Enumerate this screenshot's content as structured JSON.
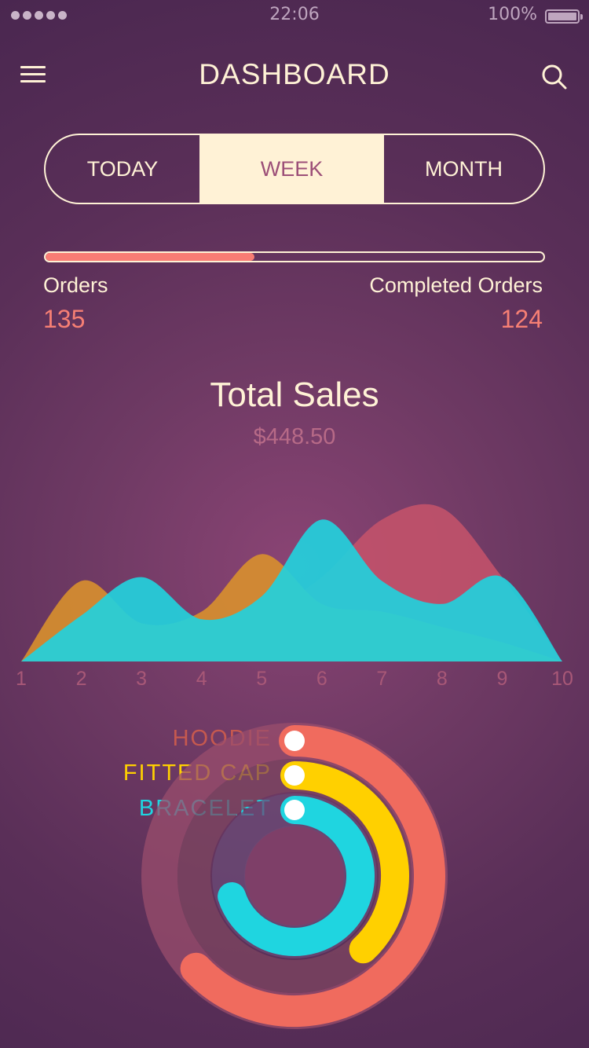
{
  "status_bar": {
    "time": "22:06",
    "battery": "100%"
  },
  "header": {
    "title": "DASHBOARD"
  },
  "tabs": [
    {
      "label": "TODAY",
      "active": false
    },
    {
      "label": "WEEK",
      "active": true
    },
    {
      "label": "MONTH",
      "active": false
    }
  ],
  "progress": {
    "fraction": 0.42
  },
  "orders": {
    "label": "Orders",
    "value": "135"
  },
  "completed_orders": {
    "label": "Completed Orders",
    "value": "124"
  },
  "sales": {
    "title": "Total Sales",
    "value": "$448.50"
  },
  "chart_data": {
    "type": "area",
    "x": [
      1,
      2,
      3,
      4,
      5,
      6,
      7,
      8,
      9,
      10
    ],
    "tick_labels": [
      "1",
      "2",
      "3",
      "4",
      "5",
      "6",
      "7",
      "8",
      "9",
      "10"
    ],
    "series": [
      {
        "color": "#c2526a",
        "values": [
          0,
          45,
          10,
          30,
          60,
          110,
          185,
          200,
          110,
          0
        ]
      },
      {
        "color": "#d8902e",
        "values": [
          0,
          105,
          50,
          65,
          140,
          75,
          65,
          45,
          25,
          0
        ]
      },
      {
        "color": "#24d0dc",
        "values": [
          0,
          60,
          110,
          55,
          85,
          185,
          105,
          75,
          110,
          0
        ]
      }
    ]
  },
  "ring_chart": [
    {
      "label": "HOODIE",
      "fraction": 0.63,
      "color": "#f06b5e",
      "track": "#9a4d6c"
    },
    {
      "label": "FITTED CAP",
      "fraction": 0.38,
      "color": "#ffd000",
      "track": "#7d4660"
    },
    {
      "label": "BRACELET",
      "fraction": 0.7,
      "color": "#1fd5e0",
      "track": "#6a4b77"
    }
  ]
}
